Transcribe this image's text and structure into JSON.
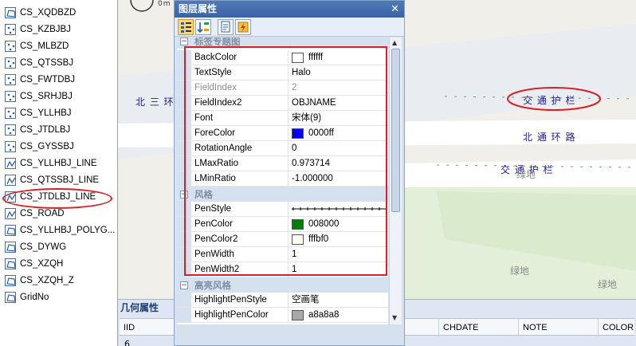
{
  "layer_tree": {
    "items": [
      {
        "label": "CS_XQDBZD",
        "icon": "polygon-layer-icon"
      },
      {
        "label": "CS_KZBJBJ",
        "icon": "point-layer-icon"
      },
      {
        "label": "CS_MLBZD",
        "icon": "point-layer-icon"
      },
      {
        "label": "CS_QTSSBJ",
        "icon": "point-layer-icon"
      },
      {
        "label": "CS_FWTDBJ",
        "icon": "point-layer-icon"
      },
      {
        "label": "CS_SRHJBJ",
        "icon": "point-layer-icon"
      },
      {
        "label": "CS_YLLHBJ",
        "icon": "point-layer-icon"
      },
      {
        "label": "CS_JTDLBJ",
        "icon": "point-layer-icon"
      },
      {
        "label": "CS_GYSSBJ",
        "icon": "point-layer-icon"
      },
      {
        "label": "CS_YLLHBJ_LINE",
        "icon": "line-layer-icon"
      },
      {
        "label": "CS_QTSSBJ_LINE",
        "icon": "line-layer-icon"
      },
      {
        "label": "CS_JTDLBJ_LINE",
        "icon": "line-layer-icon"
      },
      {
        "label": "CS_ROAD",
        "icon": "line-layer-icon"
      },
      {
        "label": "CS_YLLHBJ_POLYG...",
        "icon": "polygon-layer-icon"
      },
      {
        "label": "CS_DYWG",
        "icon": "polygon-layer-icon"
      },
      {
        "label": "CS_XZQH",
        "icon": "polygon-layer-icon"
      },
      {
        "label": "CS_XZQH_Z",
        "icon": "polygon-layer-icon"
      },
      {
        "label": "GridNo",
        "icon": "polygon-layer-icon"
      }
    ]
  },
  "map": {
    "scale_label": "0m",
    "road_label_1": "交 通 护 栏",
    "road_label_2": "北 通 环 路",
    "road_label_3": "交 通 护 栏",
    "road_label_left": "北 三 环",
    "green_1": "绿地",
    "green_2": "绿地",
    "green_3": "绿地"
  },
  "panel": {
    "title": "图层属性",
    "close": "✕",
    "category_label": "标签专题图",
    "category_style": "风格",
    "category_highlight": "高亮风格",
    "properties": [
      {
        "name": "BackColor",
        "value": "ffffff",
        "swatch": "#ffffff"
      },
      {
        "name": "TextStyle",
        "value": "Halo"
      },
      {
        "name": "FieldIndex",
        "value": "2",
        "disabled": true
      },
      {
        "name": "FieldIndex2",
        "value": "OBJNAME"
      },
      {
        "name": "Font",
        "value": "宋体(9)"
      },
      {
        "name": "ForeColor",
        "value": "0000ff",
        "swatch": "#0000ff"
      },
      {
        "name": "RotationAngle",
        "value": "0"
      },
      {
        "name": "LMaxRatio",
        "value": "0.973714"
      },
      {
        "name": "LMinRatio",
        "value": "-1.000000"
      }
    ],
    "style_properties": [
      {
        "name": "PenStyle",
        "value": ""
      },
      {
        "name": "PenColor",
        "value": "008000",
        "swatch": "#008000"
      },
      {
        "name": "PenColor2",
        "value": "fffbf0",
        "swatch": "#fffbf0"
      },
      {
        "name": "PenWidth",
        "value": "1"
      },
      {
        "name": "PenWidth2",
        "value": "1"
      }
    ],
    "highlight_properties": [
      {
        "name": "HighlightPenStyle",
        "value": "空画笔"
      },
      {
        "name": "HighlightPenColor",
        "value": "a8a8a8",
        "swatch": "#a8a8a8"
      }
    ]
  },
  "geo": {
    "title": "几何属性",
    "columns": [
      "IID",
      "CHDATE",
      "NOTE",
      "COLOR"
    ],
    "first_cell": "6"
  }
}
